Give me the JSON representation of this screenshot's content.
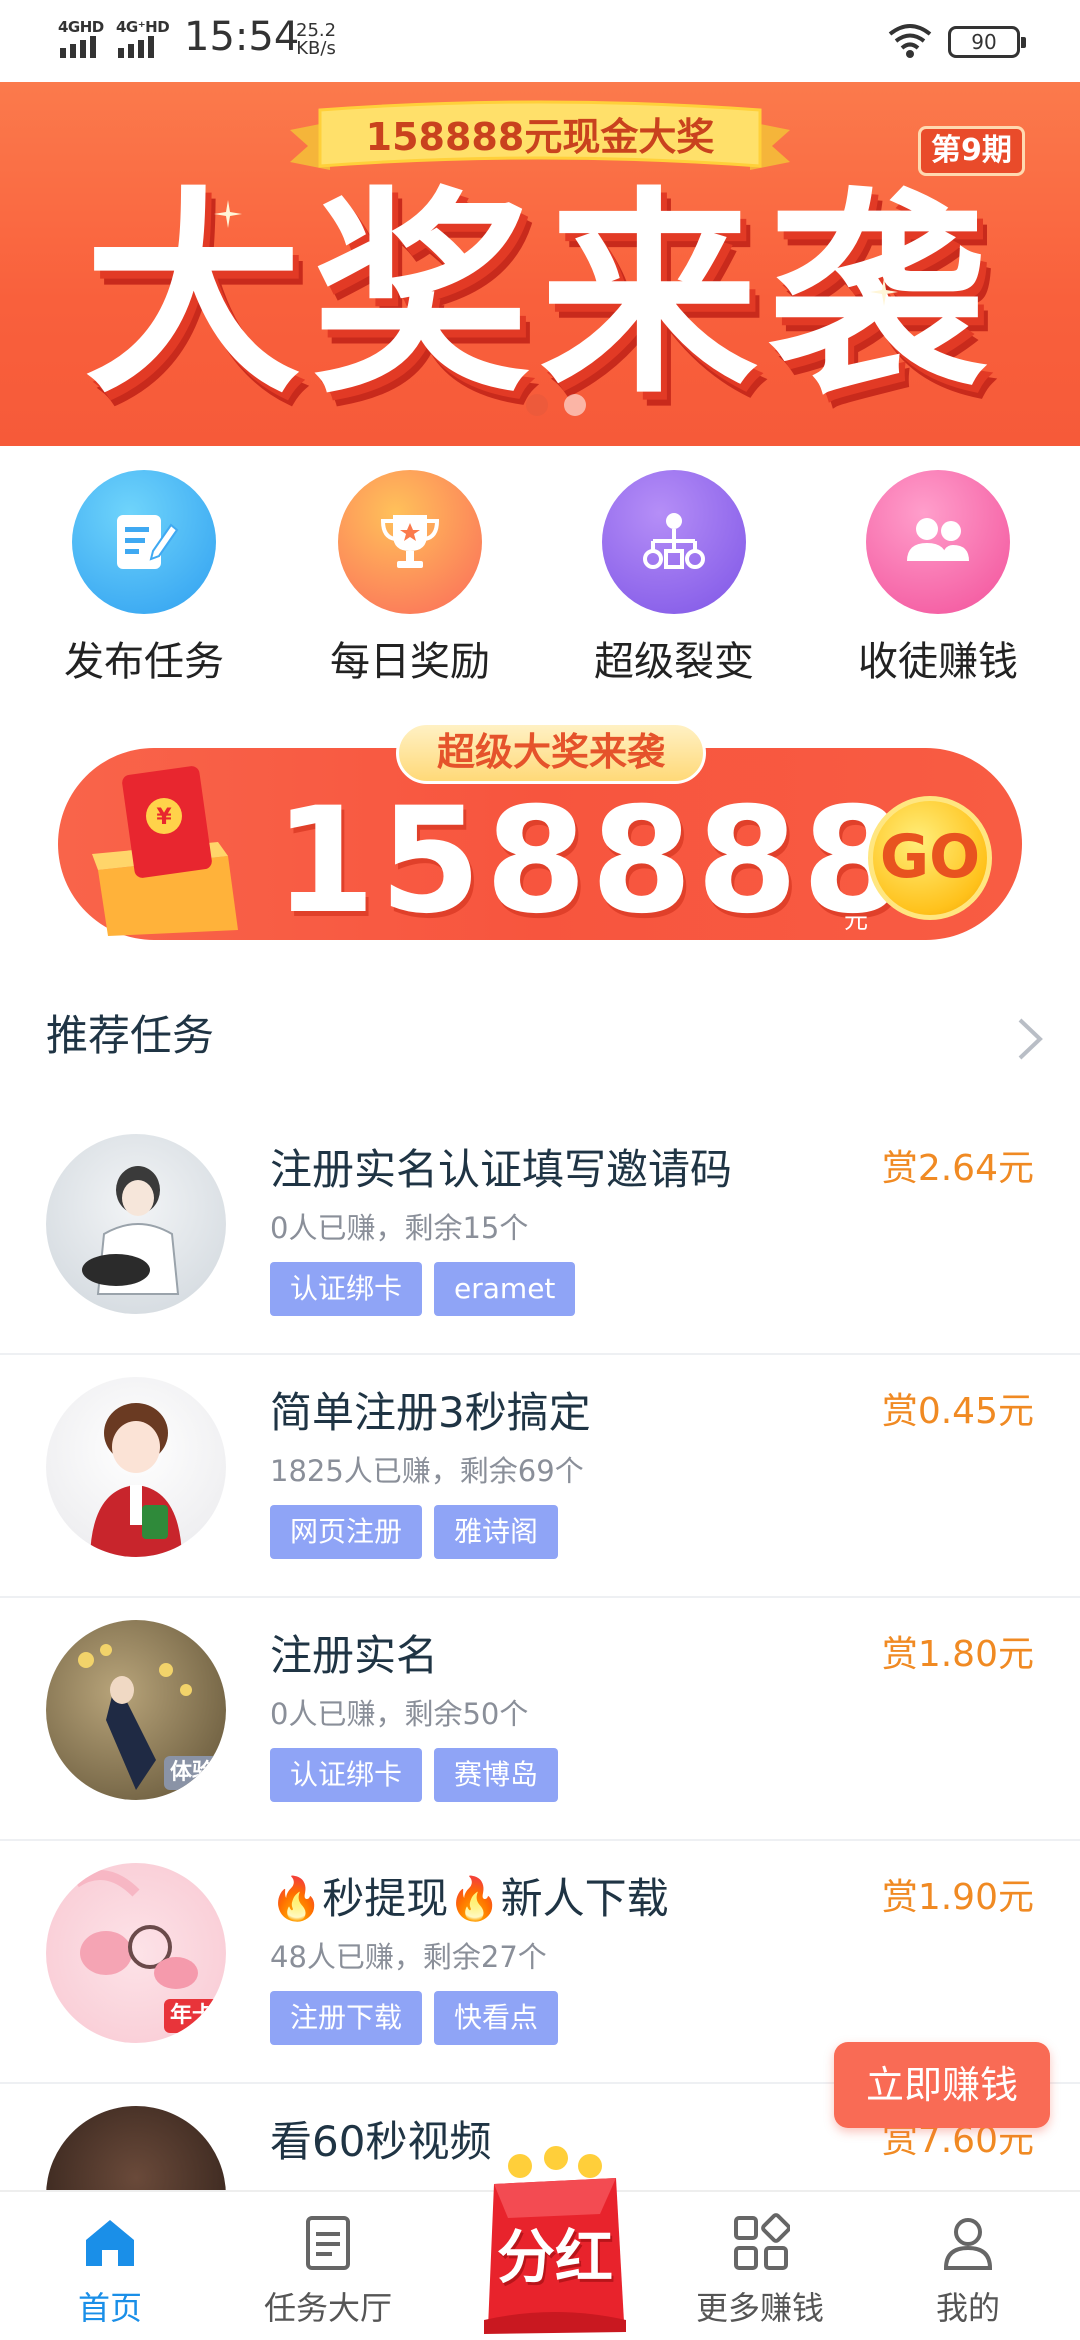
{
  "status_bar": {
    "network_1": "4GHD",
    "network_2": "4G⁺HD",
    "time": "15:54",
    "speed_value": "25.2",
    "speed_unit": "KB/s",
    "battery": "90"
  },
  "top_banner": {
    "ribbon": "158888元现金大奖",
    "period": "第9期",
    "headline": "大奖来袭",
    "slide_count": 2,
    "active_slide": 1
  },
  "features": [
    {
      "label": "发布任务",
      "icon": "edit-icon",
      "color": "#3fb4f5"
    },
    {
      "label": "每日奖励",
      "icon": "trophy-icon",
      "color": "#fb8a4c"
    },
    {
      "label": "超级裂变",
      "icon": "network-icon",
      "color": "#9a6df0"
    },
    {
      "label": "收徒赚钱",
      "icon": "users-icon",
      "color": "#f56aa6"
    }
  ],
  "mid_banner": {
    "title": "超级大奖来袭",
    "amount": "158888",
    "unit": "元",
    "go": "GO"
  },
  "section": {
    "title": "推荐任务"
  },
  "tasks": [
    {
      "title": "注册实名认证填写邀请码",
      "reward": "赏2.64元",
      "meta": "0人已赚，剩余15个",
      "tags": [
        "认证绑卡",
        "eramet"
      ],
      "badge": ""
    },
    {
      "title": "简单注册3秒搞定",
      "reward": "赏0.45元",
      "meta": "1825人已赚，剩余69个",
      "tags": [
        "网页注册",
        "雅诗阁"
      ],
      "badge": ""
    },
    {
      "title": "注册实名",
      "reward": "赏1.80元",
      "meta": "0人已赚，剩余50个",
      "tags": [
        "认证绑卡",
        "赛博岛"
      ],
      "badge": "体验"
    },
    {
      "title": "🔥秒提现🔥新人下载",
      "reward": "赏1.90元",
      "meta": "48人已赚，剩余27个",
      "tags": [
        "注册下载",
        "快看点"
      ],
      "badge": "年卡"
    },
    {
      "title": "看60秒视频",
      "reward": "赏7.60元",
      "meta": "",
      "tags": [],
      "badge": ""
    }
  ],
  "floating_button": "立即赚钱",
  "bottom_nav": {
    "home": "首页",
    "task_hall": "任务大厅",
    "center": "分红",
    "more": "更多赚钱",
    "mine": "我的",
    "active_color": "#1a8fe8"
  }
}
